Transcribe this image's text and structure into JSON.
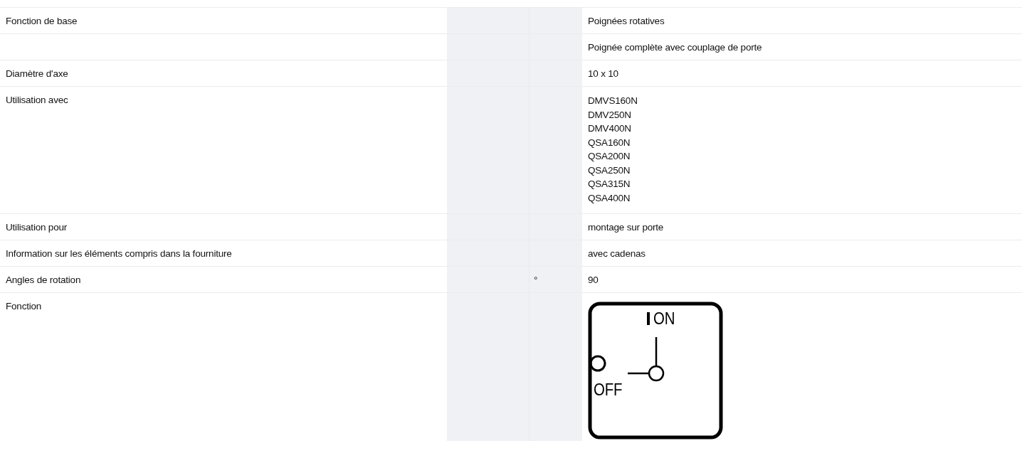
{
  "rows": [
    {
      "kind": "text",
      "label": "Fonction de base",
      "unit": "",
      "value": "Poignées rotatives"
    },
    {
      "kind": "text",
      "label": "",
      "unit": "",
      "value": "Poignée complète avec couplage de porte"
    },
    {
      "kind": "text",
      "label": "Diamètre d'axe",
      "unit": "",
      "value": "10 x 10"
    },
    {
      "kind": "list",
      "label": "Utilisation avec",
      "unit": "",
      "values": [
        "DMVS160N",
        "DMV250N",
        "DMV400N",
        "QSA160N",
        "QSA200N",
        "QSA250N",
        "QSA315N",
        "QSA400N"
      ]
    },
    {
      "kind": "text",
      "label": "Utilisation pour",
      "unit": "",
      "value": "montage sur porte"
    },
    {
      "kind": "text",
      "label": "Information sur les éléments compris dans la fourniture",
      "unit": "",
      "value": "avec cadenas"
    },
    {
      "kind": "text",
      "label": "Angles de rotation",
      "unit": "°",
      "value": "90"
    },
    {
      "kind": "diagram",
      "label": "Fonction",
      "unit": "",
      "on_label": "ON",
      "off_label": "OFF"
    }
  ]
}
